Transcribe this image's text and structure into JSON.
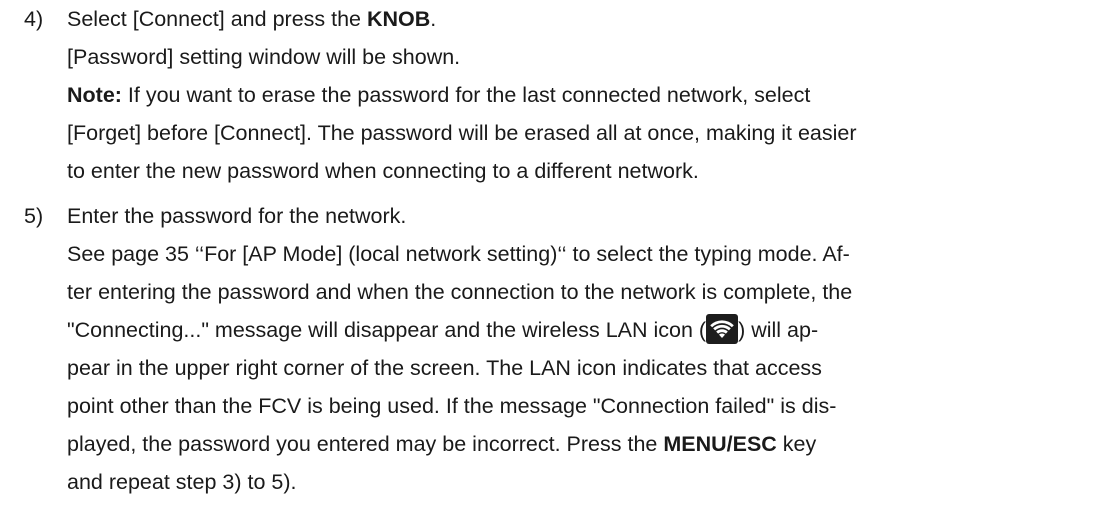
{
  "step4": {
    "number": "4)",
    "l1_a": "Select [Connect] and press the ",
    "l1_b": "KNOB",
    "l1_c": ".",
    "l2": "[Password] setting window will be shown.",
    "l3_a": "Note:",
    "l3_b": " If you want to erase the password for the last connected network, select",
    "l4": "[Forget] before [Connect]. The password will be erased all at once, making it easier",
    "l5": "to enter the new password when connecting to a different network."
  },
  "step5": {
    "number": "5)",
    "l1": "Enter the password for the network.",
    "l2": "See page 35 ‘‘For [AP Mode] (local network setting)‘‘ to select the typing mode. Af-",
    "l3": "ter entering the password and when the connection to the network is complete, the",
    "l4_a": "\"Connecting...\" message will disappear and the wireless LAN icon (",
    "l4_b": ") will ap-",
    "l5": "pear in the upper right corner of the screen. The LAN icon indicates that access",
    "l6": "point other than the FCV is being used. If the message \"Connection failed\" is dis-",
    "l7": "played, the password you entered may be incorrect. Press the ",
    "l7_b": "MENU/ESC",
    "l7_c": " key",
    "l8": "and repeat step 3) to 5)."
  },
  "icons": {
    "wireless_lan": "wifi-icon"
  }
}
